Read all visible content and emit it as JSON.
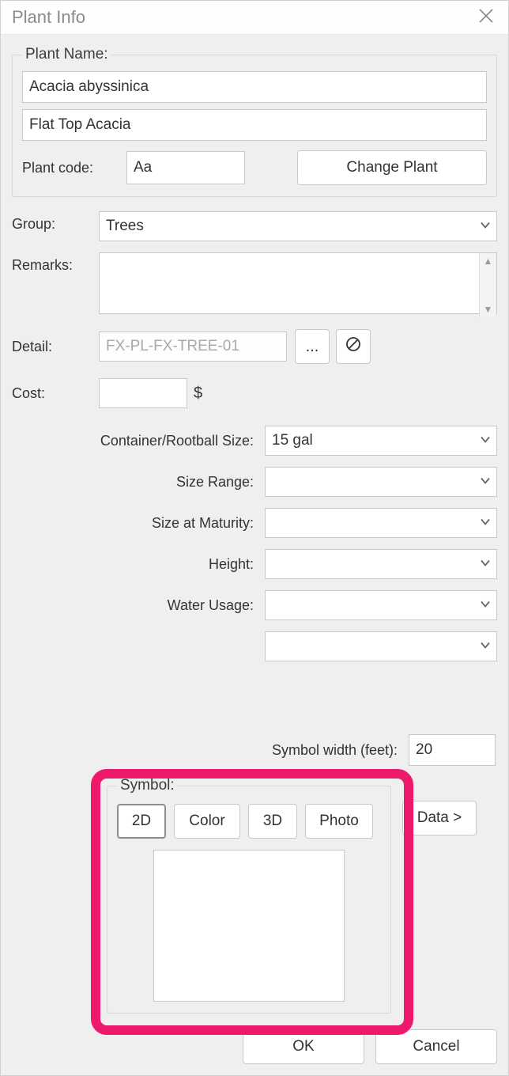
{
  "window": {
    "title": "Plant Info"
  },
  "plantName": {
    "legend": "Plant Name:",
    "scientific": "Acacia abyssinica",
    "common": "Flat Top Acacia",
    "codeLabel": "Plant code:",
    "code": "Aa",
    "changeBtn": "Change Plant"
  },
  "group": {
    "label": "Group:",
    "value": "Trees"
  },
  "remarks": {
    "label": "Remarks:",
    "value": ""
  },
  "detail": {
    "label": "Detail:",
    "value": "FX-PL-FX-TREE-01",
    "browseLabel": "...",
    "clearIcon": "no-entry-icon"
  },
  "cost": {
    "label": "Cost:",
    "value": "",
    "suffix": "$"
  },
  "sizes": {
    "containerLabel": "Container/Rootball Size:",
    "containerValue": "15 gal",
    "rangeLabel": "Size Range:",
    "rangeValue": "",
    "maturityLabel": "Size at Maturity:",
    "maturityValue": "",
    "heightLabel": "Height:",
    "heightValue": "",
    "waterLabel": "Water Usage:",
    "waterValue": "",
    "extraValue": ""
  },
  "symbolWidth": {
    "label": "Symbol width (feet):",
    "value": "20"
  },
  "symbol": {
    "legend": "Symbol:",
    "tabs": {
      "t2d": "2D",
      "color": "Color",
      "t3d": "3D",
      "photo": "Photo"
    },
    "dataBtn": "Data >"
  },
  "footer": {
    "ok": "OK",
    "cancel": "Cancel"
  }
}
